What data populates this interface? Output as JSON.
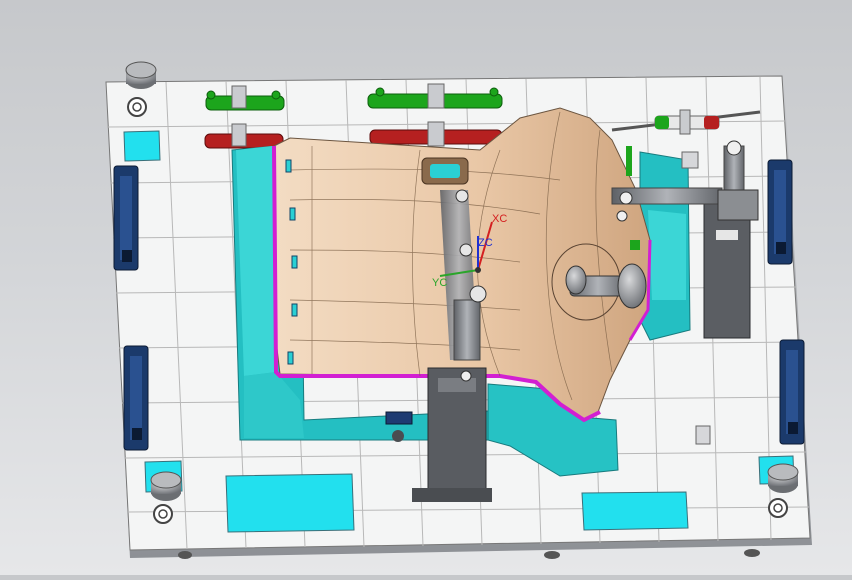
{
  "viewport": {
    "axes": {
      "x_label": "XC",
      "y_label": "YC",
      "z_label": "ZC"
    }
  },
  "colors": {
    "background_top": "#c6c8cb",
    "background_bottom": "#e6e7e9",
    "base_plate": "#f4f5f5",
    "grid_line": "#b7b7b7",
    "part_skin": "#e8c6a3",
    "support_body": "#33c8c8",
    "trim_line": "#d21fd2",
    "clamp_green": "#1ca51c",
    "clamp_red": "#b52020",
    "clamp_steel": "#9a9da2",
    "axis_x": "#d42020",
    "axis_y": "#2aa52a",
    "axis_z": "#2030d0",
    "side_handle": "#16305a"
  },
  "icons": [
    "corner-locator-icon",
    "toggle-clamp-icon",
    "coordinate-triad-icon"
  ]
}
